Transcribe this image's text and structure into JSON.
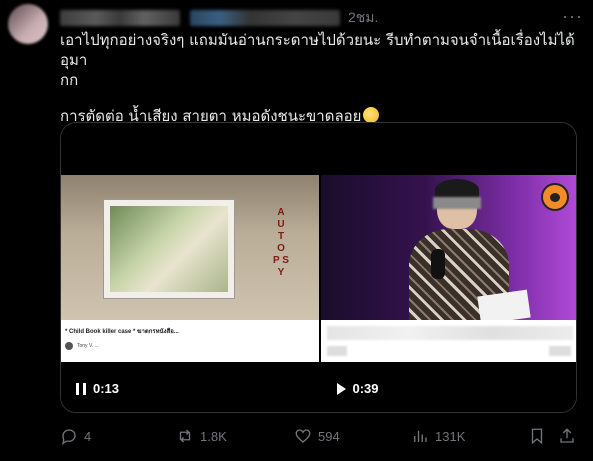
{
  "post": {
    "time": "2ชม.",
    "more_glyph": "···",
    "text_line1": "เอาไปทุกอย่างจริงๆ แถมมันอ่านกระดาษไปด้วยนะ รีบทำตามจนจำเนื้อเรื่องไม่ได้ อุมา",
    "text_line2": "กก",
    "text_line3": "การตัดต่อ น้ำเสียง สายตา หมอดังชนะขาดลอย",
    "emoji_icon": "pleading-face-icon"
  },
  "media": {
    "left_video": {
      "autopsy_letters": "A U T O P S Y",
      "caption_title": "* Child Book killer case * ฆาตกรหนังสือ...",
      "caption_sub": "Tony V. ...",
      "duration": "0:13",
      "control_icon": "pause-icon"
    },
    "right_video": {
      "duration": "0:39",
      "control_icon": "play-icon"
    }
  },
  "actions": {
    "replies": "4",
    "reposts": "1.8K",
    "likes": "594",
    "views": "131K"
  },
  "colors": {
    "background": "#000000",
    "text": "#e7e9ea",
    "muted": "#71767b",
    "border": "#2f3336"
  }
}
